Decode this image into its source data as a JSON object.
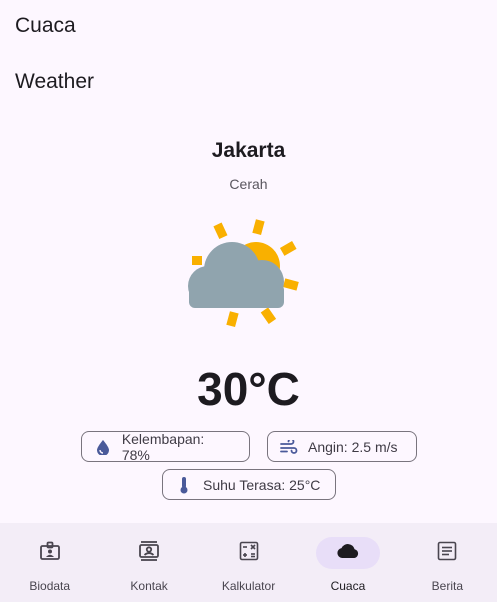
{
  "appbar": {
    "title": "Cuaca"
  },
  "page": {
    "heading": "Weather"
  },
  "weather": {
    "city": "Jakarta",
    "condition": "Cerah",
    "temperature": "30°C",
    "icon": "partly-cloudy-icon"
  },
  "details": {
    "humidity": {
      "icon": "water-drop-icon",
      "label": "Kelembapan: 78%"
    },
    "wind": {
      "icon": "wind-icon",
      "label": "Angin: 2.5 m/s"
    },
    "feels_like": {
      "icon": "thermometer-icon",
      "label": "Suhu Terasa: 25°C"
    }
  },
  "nav": {
    "items": [
      {
        "label": "Biodata",
        "icon": "id-badge-icon"
      },
      {
        "label": "Kontak",
        "icon": "contacts-icon"
      },
      {
        "label": "Kalkulator",
        "icon": "calculator-icon"
      },
      {
        "label": "Cuaca",
        "icon": "cloud-icon",
        "active": true
      },
      {
        "label": "Berita",
        "icon": "article-icon"
      }
    ]
  },
  "colors": {
    "background": "#fdf7ff",
    "nav_background": "#f3edf7",
    "active_indicator": "#e8def8",
    "sun": "#f9b000",
    "cloud": "#90a4ae",
    "icon_accent": "#4a5a9a"
  }
}
